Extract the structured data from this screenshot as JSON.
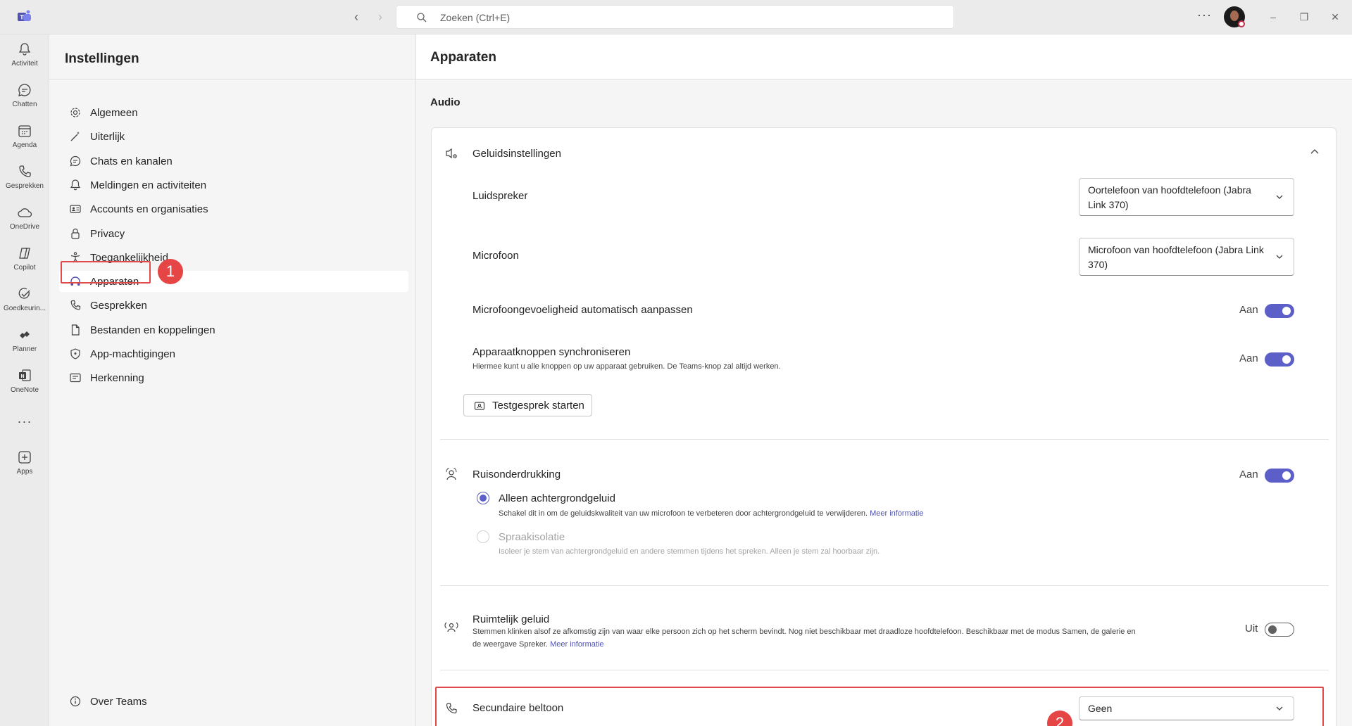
{
  "titlebar": {
    "search_placeholder": "Zoeken (Ctrl+E)",
    "more_label": "···"
  },
  "rail": {
    "items": [
      {
        "label": "Activiteit",
        "icon": "bell-icon"
      },
      {
        "label": "Chatten",
        "icon": "chat-icon"
      },
      {
        "label": "Agenda",
        "icon": "calendar-icon"
      },
      {
        "label": "Gesprekken",
        "icon": "phone-icon"
      },
      {
        "label": "OneDrive",
        "icon": "cloud-icon"
      },
      {
        "label": "Copilot",
        "icon": "copilot-icon"
      },
      {
        "label": "Goedkeurin...",
        "icon": "approvals-icon"
      },
      {
        "label": "Planner",
        "icon": "planner-icon"
      },
      {
        "label": "OneNote",
        "icon": "onenote-icon"
      },
      {
        "label": "Apps",
        "icon": "add-apps-icon"
      }
    ],
    "more": "···"
  },
  "settings_nav": {
    "title": "Instellingen",
    "items": [
      {
        "label": "Algemeen",
        "icon": "gear-icon"
      },
      {
        "label": "Uiterlijk",
        "icon": "wand-icon"
      },
      {
        "label": "Chats en kanalen",
        "icon": "chat-icon"
      },
      {
        "label": "Meldingen en activiteiten",
        "icon": "bell-icon"
      },
      {
        "label": "Accounts en organisaties",
        "icon": "contact-card-icon"
      },
      {
        "label": "Privacy",
        "icon": "lock-icon"
      },
      {
        "label": "Toegankelijkheid",
        "icon": "accessibility-icon"
      },
      {
        "label": "Apparaten",
        "icon": "headset-icon",
        "selected": true
      },
      {
        "label": "Gesprekken",
        "icon": "phone-icon"
      },
      {
        "label": "Bestanden en koppelingen",
        "icon": "document-icon"
      },
      {
        "label": "App-machtigingen",
        "icon": "shield-icon"
      },
      {
        "label": "Herkenning",
        "icon": "recognition-icon"
      }
    ],
    "footer": "Over Teams",
    "annotation_1": "1"
  },
  "main": {
    "title": "Apparaten",
    "audio_heading": "Audio",
    "sound_settings": {
      "label": "Geluidsinstellingen",
      "speaker_label": "Luidspreker",
      "speaker_value": "Oortelefoon van hoofdtelefoon (Jabra Link 370)",
      "mic_label": "Microfoon",
      "mic_value": "Microfoon van hoofdtelefoon (Jabra Link 370)",
      "mic_auto_label": "Microfoongevoeligheid automatisch aanpassen",
      "mic_auto_state": "Aan",
      "sync_label": "Apparaatknoppen synchroniseren",
      "sync_desc": "Hiermee kunt u alle knoppen op uw apparaat gebruiken. De Teams-knop zal altijd werken.",
      "sync_state": "Aan",
      "test_call_button": "Testgesprek starten"
    },
    "noise": {
      "label": "Ruisonderdrukking",
      "state": "Aan",
      "option1_label": "Alleen achtergrondgeluid",
      "option1_desc": "Schakel dit in om de geluidskwaliteit van uw microfoon te verbeteren door achtergrondgeluid te verwijderen.",
      "option1_link": "Meer informatie",
      "option2_label": "Spraakisolatie",
      "option2_desc": "Isoleer je stem van achtergrondgeluid en andere stemmen tijdens het spreken. Alleen je stem zal hoorbaar zijn."
    },
    "spatial": {
      "label": "Ruimtelijk geluid",
      "desc_line1": "Stemmen klinken alsof ze afkomstig zijn van waar elke persoon zich op het scherm bevindt. Nog niet beschikbaar met draadloze hoofdtelefoon. Beschikbaar met de modus Samen, de galerie en",
      "desc_line2": "de weergave Spreker.",
      "link": "Meer informatie",
      "state": "Uit"
    },
    "secondary_ringer": {
      "label": "Secundaire beltoon",
      "value": "Geen"
    },
    "annotation_2": "2"
  },
  "colors": {
    "accent": "#5b5fc7",
    "annotation_red": "#e64545"
  }
}
